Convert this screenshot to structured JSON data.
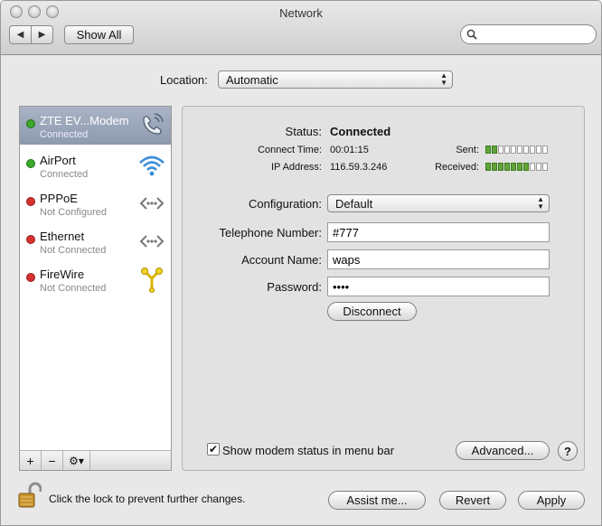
{
  "window": {
    "title": "Network"
  },
  "toolbar": {
    "back_label": "◀",
    "forward_label": "▶",
    "show_all_label": "Show All",
    "search_placeholder": ""
  },
  "location": {
    "label": "Location:",
    "value": "Automatic"
  },
  "sidebar": {
    "services": [
      {
        "name": "ZTE EV...Modem",
        "status": "Connected",
        "indicator": "#3aaa2b",
        "icon": "phone-icon"
      },
      {
        "name": "AirPort",
        "status": "Connected",
        "indicator": "#3aaa2b",
        "icon": "wifi-icon"
      },
      {
        "name": "PPPoE",
        "status": "Not Configured",
        "indicator": "#d93030",
        "icon": "ethernet-icon"
      },
      {
        "name": "Ethernet",
        "status": "Not Connected",
        "indicator": "#d93030",
        "icon": "ethernet-icon"
      },
      {
        "name": "FireWire",
        "status": "Not Connected",
        "indicator": "#d93030",
        "icon": "firewire-icon"
      }
    ],
    "tools": {
      "add_label": "+",
      "remove_label": "−",
      "action_label": "⚙▾"
    }
  },
  "detail": {
    "status_label": "Status:",
    "status_value": "Connected",
    "connect_time_label": "Connect Time:",
    "connect_time_value": "00:01:15",
    "ip_label": "IP Address:",
    "ip_value": "116.59.3.246",
    "sent_label": "Sent:",
    "sent_level": 2,
    "received_label": "Received:",
    "received_level": 7,
    "meter_segments": 10,
    "configuration_label": "Configuration:",
    "configuration_value": "Default",
    "telephone_label": "Telephone Number:",
    "telephone_value": "#777",
    "account_label": "Account Name:",
    "account_value": "waps",
    "password_label": "Password:",
    "password_value": "••••",
    "disconnect_label": "Disconnect",
    "show_modem_label": "Show modem status in menu bar",
    "show_modem_checked": true,
    "advanced_label": "Advanced...",
    "help_label": "?"
  },
  "footer": {
    "lock_text": "Click the lock to prevent further changes.",
    "assist_label": "Assist me...",
    "revert_label": "Revert",
    "apply_label": "Apply"
  },
  "colors": {
    "selection": "#8d99ad",
    "meter_on": "#62a53a"
  }
}
